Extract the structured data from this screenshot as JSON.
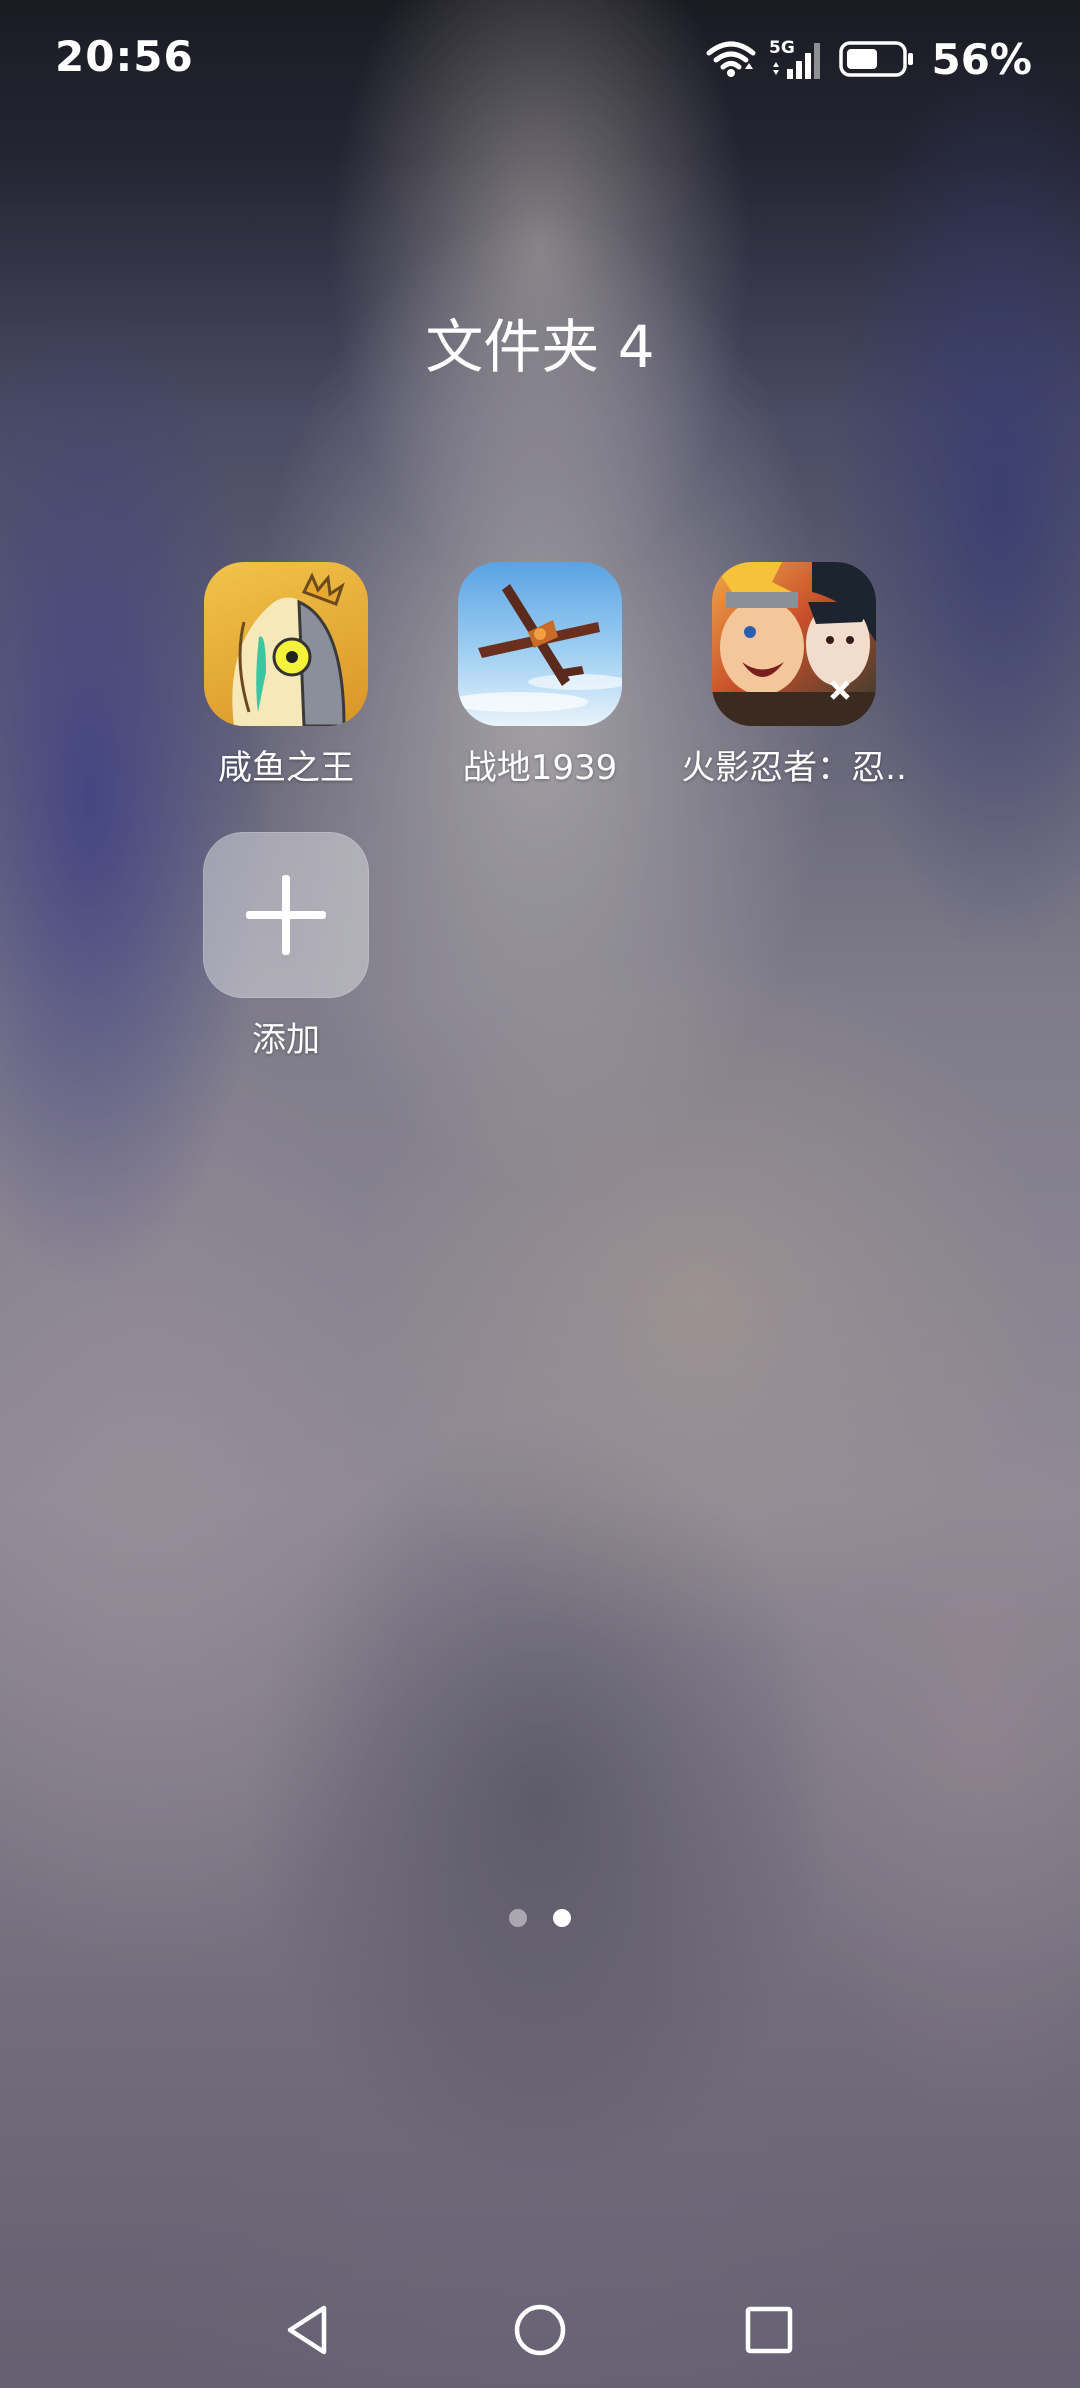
{
  "status_bar": {
    "time": "20:56",
    "network": "5G",
    "battery": "56%",
    "icons": [
      "wifi-icon",
      "cellular-signal-icon",
      "battery-icon"
    ]
  },
  "folder": {
    "title": "文件夹 4",
    "apps": [
      {
        "label": "咸鱼之王",
        "icon": "salted-fish-king-app-icon"
      },
      {
        "label": "战地1939",
        "icon": "battlefield-1939-app-icon"
      },
      {
        "label": "火影忍者：忍..",
        "icon": "naruto-app-icon"
      }
    ],
    "add": {
      "label": "添加",
      "icon": "plus-icon"
    }
  },
  "pagination": {
    "total": 2,
    "current": 2
  },
  "navigation": {
    "back": "back-icon",
    "home": "home-icon",
    "recents": "recents-icon"
  },
  "colors": {
    "text": "#ffffff",
    "dot_inactive": "rgba(255,255,255,0.45)",
    "dot_active": "#ffffff"
  }
}
